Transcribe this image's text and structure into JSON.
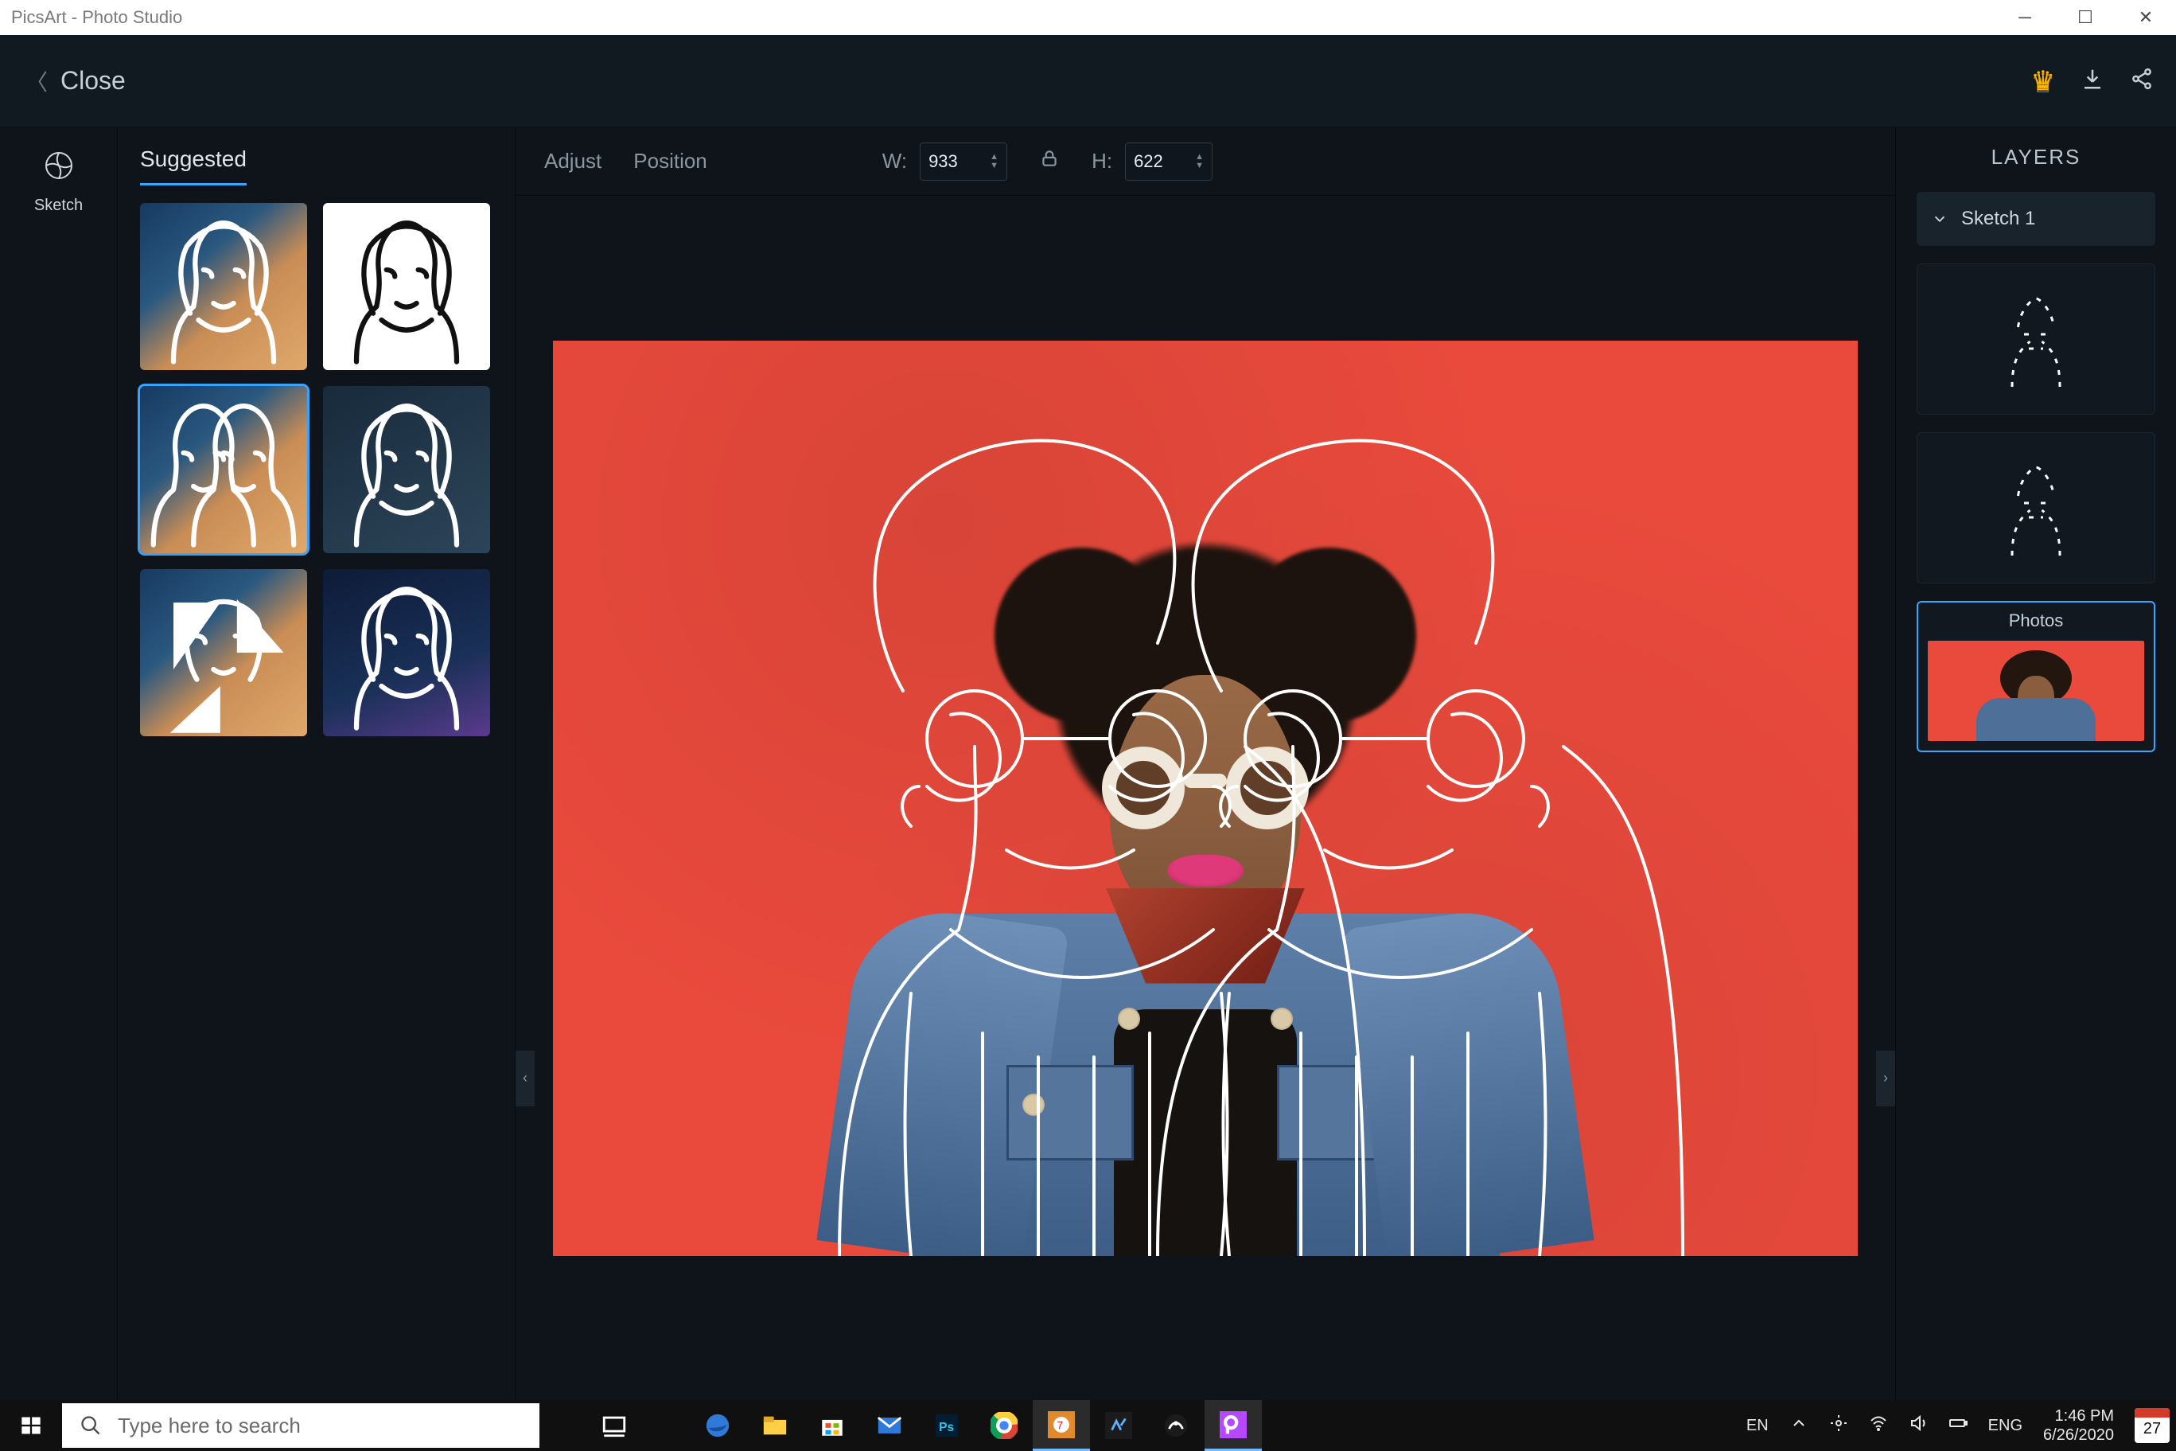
{
  "window": {
    "title": "PicsArt - Photo Studio"
  },
  "header": {
    "close_label": "Close"
  },
  "toolrail": {
    "sketch_label": "Sketch"
  },
  "suggested": {
    "tab_label": "Suggested"
  },
  "props": {
    "adjust_label": "Adjust",
    "position_label": "Position",
    "w_label": "W:",
    "h_label": "H:",
    "width_value": "933",
    "height_value": "622"
  },
  "layers": {
    "title": "LAYERS",
    "sketch_layer_label": "Sketch 1",
    "photos_label": "Photos"
  },
  "taskbar": {
    "search_placeholder": "Type here to search",
    "lang1": "EN",
    "lang2": "ENG",
    "time": "1:46 PM",
    "date": "6/26/2020",
    "cal_day": "27"
  }
}
